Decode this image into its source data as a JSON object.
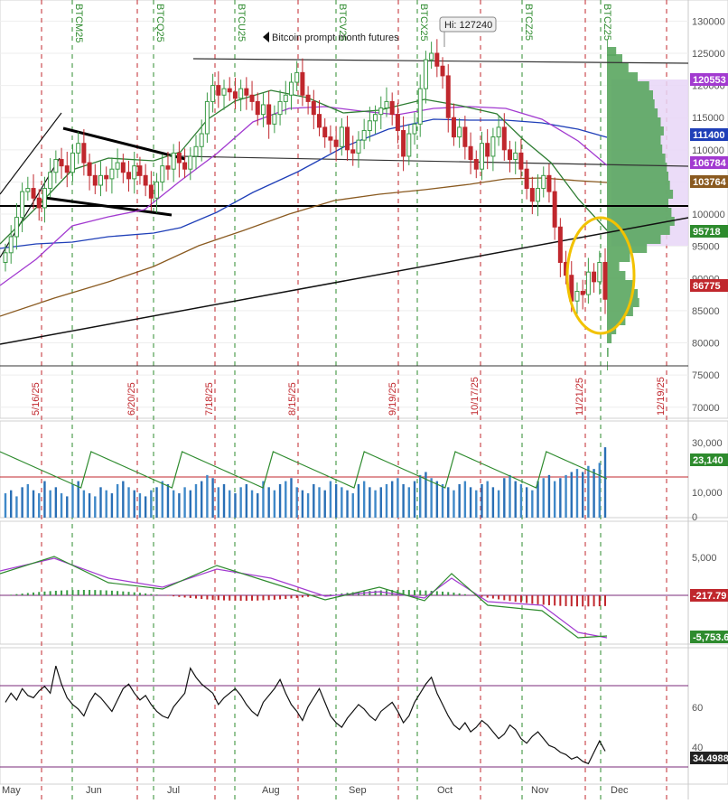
{
  "header": {
    "annotation": "Bitcoin prompt month futures",
    "high_label": "Hi: 127240"
  },
  "contract_labels": [
    "BTCM25",
    "BTCQ25",
    "BTCU25",
    "BTCV25",
    "BTCX25",
    "BTCZ25",
    "BTCZ25"
  ],
  "expiry_labels": [
    "5/16/25",
    "6/20/25",
    "7/18/25",
    "8/15/25",
    "9/19/25",
    "10/17/25",
    "11/21/25",
    "12/19/25"
  ],
  "month_labels": [
    "May",
    "Jun",
    "Jul",
    "Aug",
    "Sep",
    "Oct",
    "Nov",
    "Dec"
  ],
  "colors": {
    "up_candle": "#3a9a45",
    "down_candle": "#c0272d",
    "ma_blue": "#1f3fb8",
    "ma_purple": "#a23ad0",
    "ma_brown": "#8a5a20",
    "ma_green": "#2e7d32",
    "volume_profile": "#5aa65f",
    "value_area": "#e8d6f7",
    "highlight_circle": "#f2c200",
    "green_line": "#2e8b2e",
    "red_line": "#c0272d"
  },
  "chart_data": [
    {
      "type": "candlestick",
      "title": "",
      "annotation": "Bitcoin prompt month futures",
      "high_label": "Hi: 127240",
      "ylim": [
        68000,
        133000
      ],
      "y_ticks": [
        70000,
        75000,
        80000,
        85000,
        90000,
        95000,
        100000,
        105000,
        110000,
        115000,
        120000,
        125000,
        130000
      ],
      "price_tags": [
        {
          "value": "120553",
          "color": "#a23ad0"
        },
        {
          "value": "111400",
          "color": "#1f3fb8"
        },
        {
          "value": "106784",
          "color": "#a23ad0"
        },
        {
          "value": "103764",
          "color": "#8a5a20"
        },
        {
          "value": "95718",
          "color": "#2e8b2e"
        },
        {
          "value": "86775",
          "color": "#c0272d"
        }
      ],
      "close": [
        94000,
        96500,
        99500,
        103500,
        104000,
        102500,
        101000,
        104000,
        106500,
        108500,
        107500,
        106500,
        109500,
        111000,
        108000,
        106000,
        104500,
        106000,
        105500,
        107000,
        108000,
        106500,
        105500,
        107500,
        106000,
        104500,
        102500,
        105000,
        107500,
        107000,
        109500,
        108000,
        107000,
        109000,
        110500,
        112500,
        117500,
        120000,
        118500,
        119500,
        119000,
        118000,
        119500,
        118500,
        117500,
        115500,
        117000,
        114000,
        115500,
        117500,
        118500,
        120500,
        122000,
        118500,
        117500,
        115500,
        113500,
        112000,
        111500,
        110500,
        113500,
        110000,
        109500,
        111500,
        113000,
        114500,
        115500,
        116500,
        117500,
        115500,
        113000,
        109000,
        112500,
        114000,
        119500,
        124000,
        125000,
        123000,
        121500,
        115000,
        112000,
        113500,
        110500,
        108500,
        107000,
        111000,
        109000,
        112000,
        113500,
        110000,
        108500,
        109500,
        107000,
        104000,
        102000,
        104000,
        106000,
        103500,
        98000,
        92500,
        90500,
        86500,
        88000,
        87500,
        91000,
        89500,
        92500,
        86775
      ],
      "volume": [
        8,
        9,
        7,
        10,
        11,
        9,
        8,
        12,
        9,
        10,
        8,
        7,
        11,
        12,
        9,
        8,
        7,
        10,
        9,
        8,
        11,
        12,
        10,
        9,
        8,
        7,
        9,
        10,
        12,
        11,
        9,
        8,
        10,
        9,
        11,
        12,
        14,
        13,
        10,
        11,
        9,
        8,
        10,
        11,
        9,
        8,
        12,
        10,
        9,
        11,
        12,
        13,
        10,
        9,
        8,
        11,
        10,
        9,
        12,
        11,
        10,
        9,
        8,
        11,
        12,
        10,
        9,
        10,
        11,
        12,
        13,
        11,
        10,
        12,
        14,
        15,
        13,
        12,
        11,
        10,
        9,
        11,
        12,
        10,
        9,
        11,
        12,
        10,
        9,
        13,
        14,
        12,
        11,
        10,
        9,
        12,
        13,
        14,
        12,
        13,
        14,
        15,
        16,
        15,
        17,
        16,
        18,
        23.14
      ],
      "volume_tags": [
        "23,140"
      ],
      "volume_ticks": [
        "30,000",
        "20,000",
        "10,000",
        "0"
      ],
      "macd_tags": [
        "-217.79",
        "-5,753.6"
      ],
      "macd_ticks": [
        "5,000"
      ],
      "rsi_ticks": [
        "60",
        "40"
      ],
      "rsi_tags": [
        "34.4988"
      ],
      "rsi": [
        56,
        60,
        57,
        62,
        59,
        58,
        61,
        63,
        60,
        72,
        64,
        58,
        55,
        53,
        50,
        56,
        60,
        58,
        55,
        52,
        57,
        62,
        64,
        60,
        57,
        59,
        55,
        52,
        50,
        49,
        54,
        57,
        60,
        71,
        67,
        64,
        62,
        60,
        55,
        58,
        60,
        62,
        59,
        55,
        52,
        50,
        56,
        59,
        62,
        66,
        60,
        55,
        52,
        48,
        54,
        58,
        62,
        56,
        50,
        47,
        45,
        49,
        52,
        55,
        53,
        50,
        48,
        52,
        54,
        56,
        52,
        47,
        50,
        56,
        60,
        64,
        67,
        60,
        55,
        50,
        46,
        44,
        47,
        43,
        45,
        48,
        46,
        43,
        40,
        42,
        46,
        44,
        40,
        38,
        41,
        43,
        40,
        37,
        36,
        34,
        33,
        31,
        32,
        30,
        29,
        34,
        39,
        34.5
      ]
    }
  ]
}
